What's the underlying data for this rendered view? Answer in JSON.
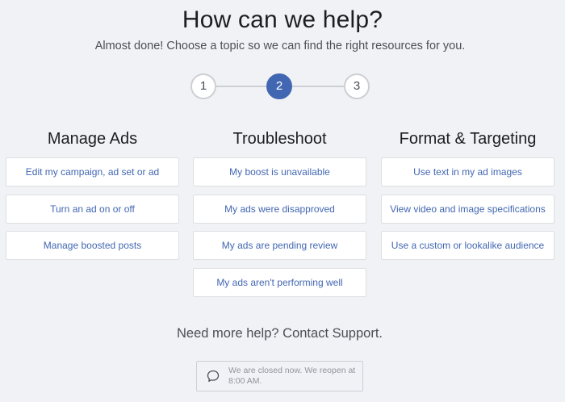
{
  "header": {
    "title": "How can we help?",
    "subtitle": "Almost done! Choose a topic so we can find the right resources for you."
  },
  "stepper": {
    "steps": [
      "1",
      "2",
      "3"
    ],
    "active_step": 2
  },
  "columns": [
    {
      "title": "Manage Ads",
      "options": [
        "Edit my campaign, ad set or ad",
        "Turn an ad on or off",
        "Manage boosted posts"
      ]
    },
    {
      "title": "Troubleshoot",
      "options": [
        "My boost is unavailable",
        "My ads were disapproved",
        "My ads are pending review",
        "My ads aren't performing well"
      ]
    },
    {
      "title": "Format & Targeting",
      "options": [
        "Use text in my ad images",
        "View video and image specifications",
        "Use a custom or lookalike audience"
      ]
    }
  ],
  "support": {
    "heading": "Need more help? Contact Support.",
    "status_icon": "chat-bubble-icon",
    "status_text": "We are closed now. We reopen at 8:00 AM."
  },
  "colors": {
    "accent": "#4267b2",
    "background": "#f1f2f5",
    "link": "#4267b2"
  }
}
